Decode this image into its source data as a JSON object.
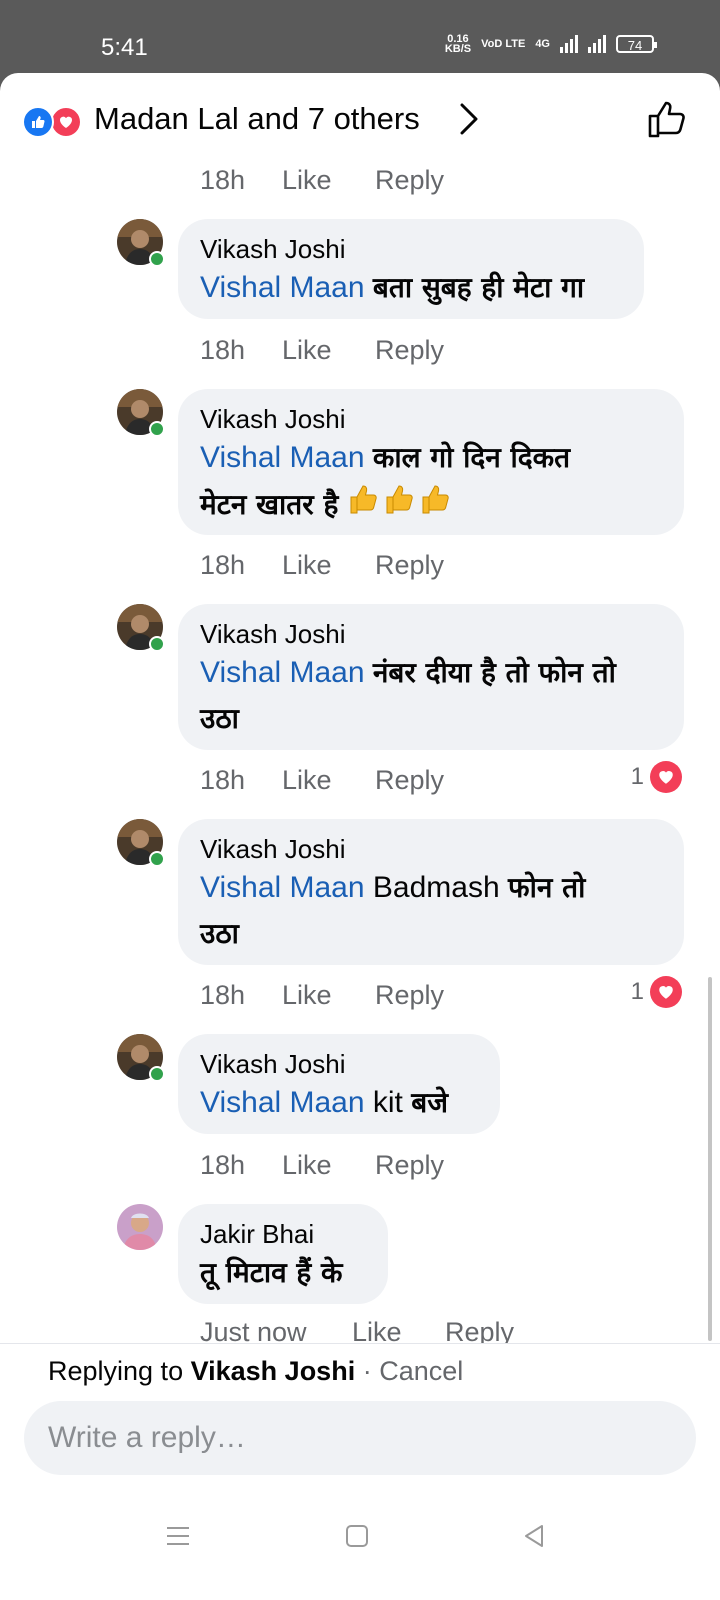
{
  "status_bar": {
    "time": "5:41",
    "net_speed": "0.16",
    "net_unit": "KB/S",
    "net_type": "VoD LTE",
    "signal_label": "4G",
    "battery": "74"
  },
  "header": {
    "title": "Madan Lal and 7 others",
    "reactions": [
      "like-icon",
      "love-icon"
    ]
  },
  "top_meta": {
    "time": "18h",
    "like": "Like",
    "reply": "Reply"
  },
  "comments": [
    {
      "author": "Vikash Joshi",
      "mention": "Vishal Maan",
      "text": "बता सुबह ही मेटा गा",
      "text2": "",
      "time": "18h",
      "like": "Like",
      "reply": "Reply",
      "reaction_count": ""
    },
    {
      "author": "Vikash Joshi",
      "mention": "Vishal Maan",
      "text": "काल गो दिन दिकत",
      "text2": "मेटन खातर है",
      "time": "18h",
      "like": "Like",
      "reply": "Reply",
      "reaction_count": ""
    },
    {
      "author": "Vikash Joshi",
      "mention": "Vishal Maan",
      "text": "नंबर दीया है तो फोन तो",
      "text2": "उठा",
      "time": "18h",
      "like": "Like",
      "reply": "Reply",
      "reaction_count": "1"
    },
    {
      "author": "Vikash Joshi",
      "mention": "Vishal Maan",
      "text_latin": "Badmash",
      "text": "फोन तो",
      "text2": "उठा",
      "time": "18h",
      "like": "Like",
      "reply": "Reply",
      "reaction_count": "1"
    },
    {
      "author": "Vikash Joshi",
      "mention": "Vishal Maan",
      "text_latin": "kit",
      "text": "बजे",
      "text2": "",
      "time": "18h",
      "like": "Like",
      "reply": "Reply",
      "reaction_count": ""
    },
    {
      "author": "Jakir Bhai",
      "mention": "",
      "text": "तू मिटाव हैं के",
      "text2": "",
      "time": "Just now",
      "like": "Like",
      "reply": "Reply",
      "reaction_count": ""
    }
  ],
  "reply_bar": {
    "replying_prefix": "Replying to",
    "replying_name": "Vikash Joshi",
    "separator": "·",
    "cancel": "Cancel",
    "placeholder": "Write a reply…"
  },
  "colors": {
    "facebook_blue": "#1877f2",
    "love_red": "#f33e58",
    "mention_blue": "#1a5fb4",
    "bubble_bg": "#f0f2f5",
    "meta_gray": "#65676b",
    "online_green": "#31a24c"
  }
}
